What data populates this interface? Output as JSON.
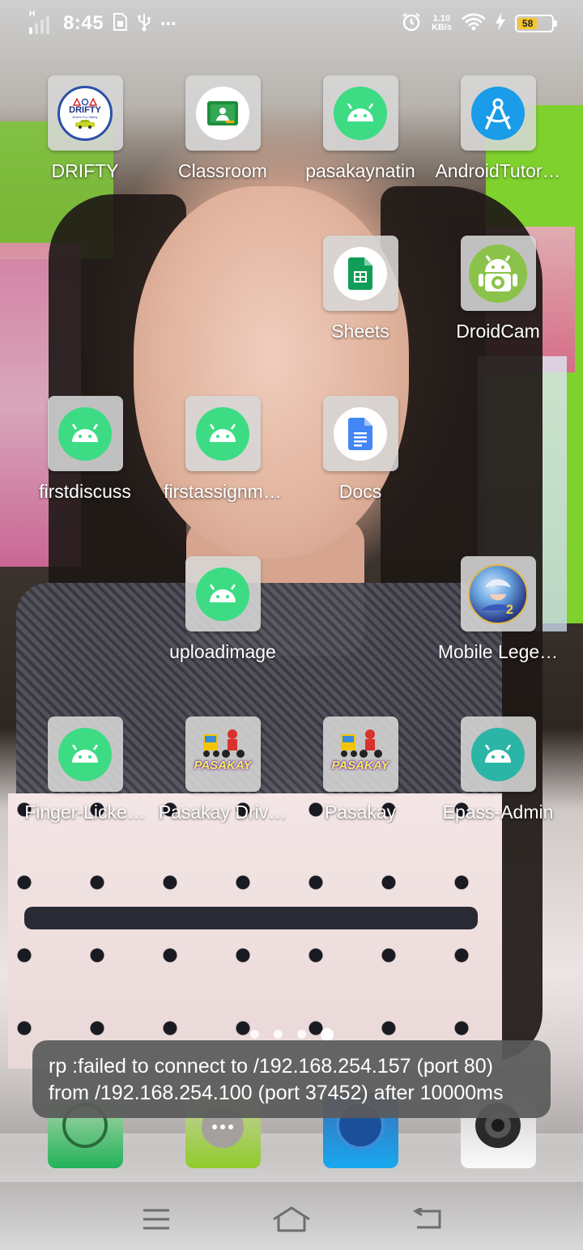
{
  "status_bar": {
    "network_type": "H",
    "time": "8:45",
    "net_speed_value": "1.10",
    "net_speed_unit": "KB/s",
    "battery_level": "58",
    "icons": [
      "signal-icon",
      "sim-icon",
      "usb-icon",
      "more-icon",
      "alarm-icon",
      "wifi-icon",
      "charging-icon",
      "battery-icon"
    ]
  },
  "apps": [
    {
      "label": "DRIFTY",
      "icon": "drifty-icon"
    },
    {
      "label": "Classroom",
      "icon": "classroom-icon"
    },
    {
      "label": "pasakaynatin",
      "icon": "android-icon"
    },
    {
      "label": "AndroidTutor…",
      "icon": "android-studio-icon"
    },
    {
      "label": "Sheets",
      "icon": "sheets-icon"
    },
    {
      "label": "DroidCam",
      "icon": "droidcam-icon"
    },
    {
      "label": "firstdiscuss",
      "icon": "android-icon"
    },
    {
      "label": "firstassignm…",
      "icon": "android-icon"
    },
    {
      "label": "Docs",
      "icon": "docs-icon"
    },
    {
      "label": "uploadimage",
      "icon": "android-icon"
    },
    {
      "label": "Mobile Lege…",
      "icon": "mobile-legends-icon"
    },
    {
      "label": "Finger-Licke…",
      "icon": "android-icon"
    },
    {
      "label": "Pasakay Driv…",
      "icon": "pasakay-icon"
    },
    {
      "label": "Pasakay",
      "icon": "pasakay-icon"
    },
    {
      "label": "Epass-Admin",
      "icon": "android-icon"
    }
  ],
  "drifty_logo_text": "DRIFTY",
  "drifty_logo_tagline": "Driven For Safety",
  "pasakay_logo_text": "PASAKAY",
  "page_indicator": {
    "count": 4,
    "active": 4
  },
  "dock": [
    "phone-icon",
    "messages-icon",
    "browser-icon",
    "camera-icon"
  ],
  "toast": {
    "message": "rp :failed to connect to /192.168.254.157 (port 80) from /192.168.254.100 (port 37452) after 10000ms"
  },
  "nav_bar": [
    "menu-icon",
    "home-icon",
    "back-icon"
  ],
  "colors": {
    "android_green": "#3ddc84",
    "battery_yellow": "#f7c52c",
    "toast_bg": "#5a5a5a"
  }
}
